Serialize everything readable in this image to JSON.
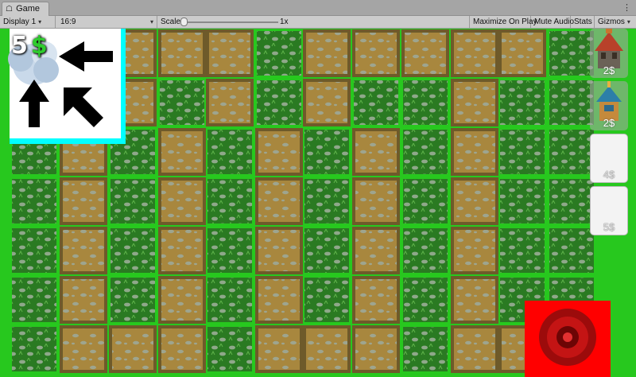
{
  "window": {
    "tab_title": "Game",
    "tab_icon": "game-controller-icon"
  },
  "toolbar": {
    "display": "Display 1",
    "aspect": "16:9",
    "scale_label": "Scale",
    "scale_value": "1x",
    "scale_level": 0.0,
    "maximize_on_play": "Maximize On Play",
    "mute_audio": "Mute Audio",
    "stats": "Stats",
    "gizmos": "Gizmos"
  },
  "hud": {
    "money_amount": "5",
    "money_symbol": "$"
  },
  "shop": [
    {
      "price": "2$",
      "icon": "red-roof-tower-icon",
      "filled": true
    },
    {
      "price": "2$",
      "icon": "blue-roof-tower-icon",
      "filled": true
    },
    {
      "price": "4$",
      "icon": "empty-slot",
      "filled": false
    },
    {
      "price": "5$",
      "icon": "empty-slot",
      "filled": false
    }
  ],
  "colors": {
    "grass_border": "#27c81e",
    "grass_fill": "#2a7a22",
    "path_fill": "#a8873e",
    "path_border": "#6e5a2a",
    "goal": "#ff0000",
    "spawn_highlight": "#00ffff"
  }
}
